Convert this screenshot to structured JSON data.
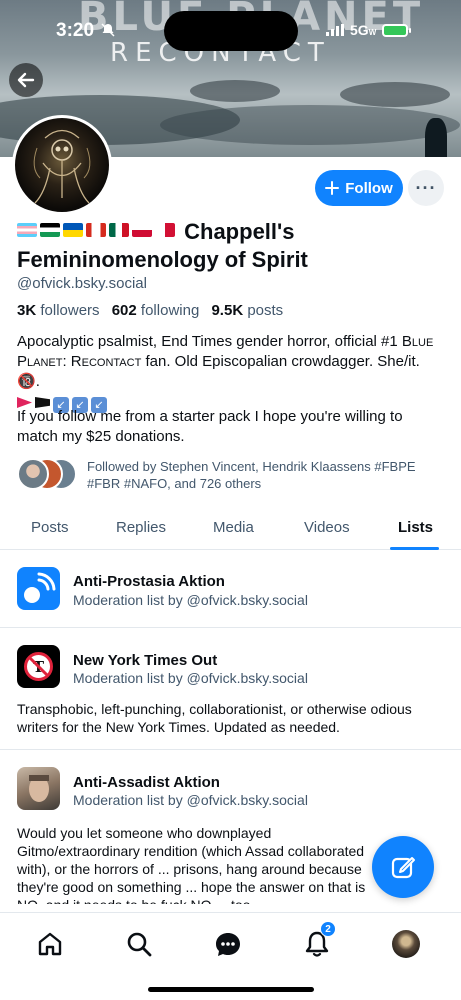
{
  "status_bar": {
    "time": "3:20",
    "network": "5G",
    "network_sub": "W"
  },
  "banner": {
    "title": "BLUE PLANET",
    "subtitle": "RECONTACT"
  },
  "profile": {
    "name_flags": [
      "trans",
      "palestine",
      "ukraine",
      "canada",
      "mexico",
      "greenland",
      "panama"
    ],
    "name_line1": "Chappell's",
    "name_line2": "Femininomenology of Spirit",
    "handle": "@ofvick.bsky.social",
    "followers_count": "3K",
    "followers_label": "followers",
    "following_count": "602",
    "following_label": "following",
    "posts_count": "9.5K",
    "posts_label": "posts",
    "bio_part1": "Apocalyptic psalmist, End Times gender horror, official #1 ",
    "bio_sc": "Blue Planet: Recontact",
    "bio_part2": " fan. Old Episcopalian crowdagger. She/it. ",
    "bio_emoji_18": "🔞",
    "bio_emoji_18_after": ".",
    "bio_line2": "If you follow me from a starter pack I hope you're willing to match my $25 donations.",
    "followed_by": "Followed by Stephen Vincent, Hendrik Klaassens #FBPE #FBR #NAFO, and 726 others"
  },
  "buttons": {
    "follow": "Follow",
    "more": "···"
  },
  "tabs": [
    "Posts",
    "Replies",
    "Media",
    "Videos",
    "Lists"
  ],
  "active_tab": "Lists",
  "lists": [
    {
      "title": "Anti-Prostasia Aktion",
      "subtitle": "Moderation list by @ofvick.bsky.social",
      "description": "",
      "icon": "blue-antenna-icon"
    },
    {
      "title": "New York Times Out",
      "subtitle": "Moderation list by @ofvick.bsky.social",
      "description": "Transphobic, left-punching, collaborationist, or otherwise odious writers for the New York Times. Updated as needed.",
      "icon": "nyt-prohibited-icon"
    },
    {
      "title": "Anti-Assadist Aktion",
      "subtitle": "Moderation list by @ofvick.bsky.social",
      "description": "Would you let someone who downplayed Gitmo/extraordinary rendition (which Assad collaborated with), or the horrors of ... prisons, hang around because they're good on something ... hope the answer on that is NO, and it needs to be fuck NO ... too.",
      "icon": "portrait-photo-icon"
    }
  ],
  "nav": {
    "notifications_badge": "2"
  },
  "colors": {
    "accent": "#1083fe",
    "text_muted": "#42576c",
    "divider": "#e3e8ed"
  }
}
